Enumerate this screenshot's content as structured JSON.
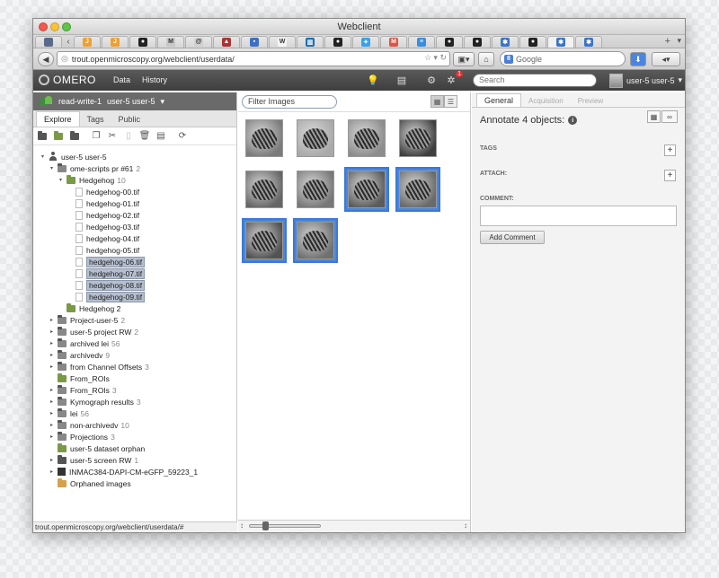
{
  "window": {
    "title": "Webclient"
  },
  "browser": {
    "url": "trout.openmicroscopy.org/webclient/userdata/",
    "search_placeholder": "Google",
    "tabs": [
      {
        "icon": "checker-favicon",
        "color": "#5a6b8a",
        "glyph": ""
      },
      {
        "icon": "jira-favicon",
        "color": "#f0a030",
        "glyph": "J"
      },
      {
        "icon": "jira-favicon",
        "color": "#f0a030",
        "glyph": "J"
      },
      {
        "icon": "github-favicon",
        "color": "#222222",
        "glyph": "●"
      },
      {
        "icon": "gmail-favicon",
        "color": "#c7c7c7",
        "glyph": "M"
      },
      {
        "icon": "debian-favicon",
        "color": "#d0d0d0",
        "glyph": "@"
      },
      {
        "icon": "app-favicon",
        "color": "#a33",
        "glyph": "▲"
      },
      {
        "icon": "window-favicon",
        "color": "#3c6fc4",
        "glyph": "▪"
      },
      {
        "icon": "wikipedia-favicon",
        "color": "#f5f5f5",
        "glyph": "W"
      },
      {
        "icon": "trello-favicon",
        "color": "#1a6fb8",
        "glyph": "▥"
      },
      {
        "icon": "github-favicon",
        "color": "#222222",
        "glyph": "●"
      },
      {
        "icon": "twitter-favicon",
        "color": "#3aa0e8",
        "glyph": "✦"
      },
      {
        "icon": "gmail-favicon",
        "color": "#d54",
        "glyph": "M"
      },
      {
        "icon": "chat-favicon",
        "color": "#3b8de0",
        "glyph": "≡"
      },
      {
        "icon": "github-favicon",
        "color": "#222222",
        "glyph": "●"
      },
      {
        "icon": "github-favicon",
        "color": "#222222",
        "glyph": "●"
      },
      {
        "icon": "omero-favicon",
        "color": "#3a74c9",
        "glyph": "✱"
      },
      {
        "icon": "github-favicon",
        "color": "#222222",
        "glyph": "●"
      },
      {
        "icon": "omero-favicon",
        "color": "#3a74c9",
        "glyph": "✱"
      },
      {
        "icon": "omero-favicon",
        "color": "#3a74c9",
        "glyph": "✱"
      }
    ]
  },
  "app": {
    "logo": "OMERO",
    "nav": [
      "Data",
      "History"
    ],
    "search_placeholder": "Search",
    "user": "user-5 user-5",
    "notification_count": "1"
  },
  "left_panel": {
    "group": "read-write-1",
    "group_user": "user-5 user-5",
    "tabs": [
      "Explore",
      "Tags",
      "Public"
    ],
    "status_url": "trout.openmicroscopy.org/webclient/userdata/#",
    "tree": [
      {
        "level": 0,
        "type": "user",
        "label": "user-5 user-5",
        "expander": "▾"
      },
      {
        "level": 1,
        "type": "project",
        "label": "ome-scripts pr #61",
        "count": "2",
        "expander": "▾"
      },
      {
        "level": 2,
        "type": "dataset",
        "label": "Hedgehog",
        "count": "10",
        "expander": "▾"
      },
      {
        "level": 3,
        "type": "image",
        "label": "hedgehog-00.tif"
      },
      {
        "level": 3,
        "type": "image",
        "label": "hedgehog-01.tif"
      },
      {
        "level": 3,
        "type": "image",
        "label": "hedgehog-02.tif"
      },
      {
        "level": 3,
        "type": "image",
        "label": "hedgehog-03.tif"
      },
      {
        "level": 3,
        "type": "image",
        "label": "hedgehog-04.tif"
      },
      {
        "level": 3,
        "type": "image",
        "label": "hedgehog-05.tif"
      },
      {
        "level": 3,
        "type": "image",
        "label": "hedgehog-06.tif",
        "selected": true
      },
      {
        "level": 3,
        "type": "image",
        "label": "hedgehog-07.tif",
        "selected": true
      },
      {
        "level": 3,
        "type": "image",
        "label": "hedgehog-08.tif",
        "selected": true
      },
      {
        "level": 3,
        "type": "image",
        "label": "hedgehog-09.tif",
        "selected": true
      },
      {
        "level": 2,
        "type": "dataset",
        "label": "Hedgehog 2"
      },
      {
        "level": 1,
        "type": "project",
        "label": "Project-user-5",
        "count": "2",
        "expander": "▸"
      },
      {
        "level": 1,
        "type": "project",
        "label": "user-5 project RW",
        "count": "2",
        "expander": "▸"
      },
      {
        "level": 1,
        "type": "project",
        "label": "archived lei",
        "count": "56",
        "expander": "▸"
      },
      {
        "level": 1,
        "type": "project",
        "label": "archivedv",
        "count": "9",
        "expander": "▸"
      },
      {
        "level": 1,
        "type": "project",
        "label": "from Channel Offsets",
        "count": "3",
        "expander": "▸"
      },
      {
        "level": 1,
        "type": "dataset",
        "label": "From_ROIs"
      },
      {
        "level": 1,
        "type": "project",
        "label": "From_ROIs",
        "count": "3",
        "expander": "▸"
      },
      {
        "level": 1,
        "type": "project",
        "label": "Kymograph results",
        "count": "3",
        "expander": "▸"
      },
      {
        "level": 1,
        "type": "project",
        "label": "lei",
        "count": "56",
        "expander": "▸"
      },
      {
        "level": 1,
        "type": "project",
        "label": "non-archivedv",
        "count": "10",
        "expander": "▸"
      },
      {
        "level": 1,
        "type": "project",
        "label": "Projections",
        "count": "3",
        "expander": "▸"
      },
      {
        "level": 1,
        "type": "dataset",
        "label": "user-5 dataset orphan"
      },
      {
        "level": 1,
        "type": "screen",
        "label": "user-5 screen RW",
        "count": "1",
        "expander": "▸"
      },
      {
        "level": 1,
        "type": "plate",
        "label": "INMAC384-DAPI-CM-eGFP_59223_1",
        "expander": "▸"
      },
      {
        "level": 1,
        "type": "orphaned",
        "label": "Orphaned images"
      }
    ]
  },
  "center_panel": {
    "filter_placeholder": "Filter Images",
    "zoom_fraction": 0.2,
    "thumbnails": [
      {
        "name": "hedgehog-00",
        "selected": false,
        "tone": "#7b7b7b"
      },
      {
        "name": "hedgehog-01",
        "selected": false,
        "tone": "#a9a9a9"
      },
      {
        "name": "hedgehog-02",
        "selected": false,
        "tone": "#8c8c8c"
      },
      {
        "name": "hedgehog-03",
        "selected": false,
        "tone": "#3f3f3f"
      },
      {
        "name": "hedgehog-04",
        "selected": false,
        "tone": "#666666"
      },
      {
        "name": "hedgehog-05",
        "selected": false,
        "tone": "#777777"
      },
      {
        "name": "hedgehog-06",
        "selected": true,
        "tone": "#5c5c5c"
      },
      {
        "name": "hedgehog-07",
        "selected": true,
        "tone": "#6a6a6a"
      },
      {
        "name": "hedgehog-08",
        "selected": true,
        "tone": "#525252"
      },
      {
        "name": "hedgehog-09",
        "selected": true,
        "tone": "#707070"
      }
    ]
  },
  "right_panel": {
    "tabs": [
      "General",
      "Acquisition",
      "Preview"
    ],
    "heading": "Annotate 4 objects:",
    "tags_label": "TAGS",
    "attach_label": "ATTACH:",
    "comment_label": "COMMENT:",
    "add_comment": "Add Comment"
  }
}
